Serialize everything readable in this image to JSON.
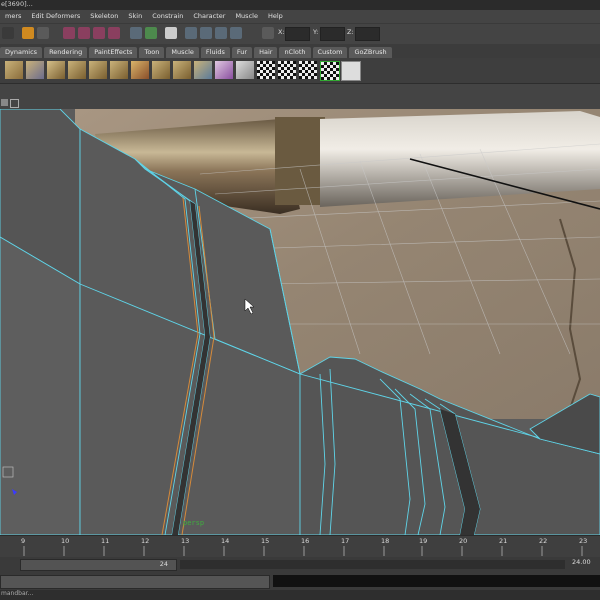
{
  "window": {
    "title": "e[3690]..."
  },
  "menubar": {
    "items": [
      "mers",
      "Edit Deformers",
      "Skeleton",
      "Skin",
      "Constrain",
      "Character",
      "Muscle",
      "Help"
    ]
  },
  "statusline": {
    "x_label": "X:",
    "y_label": "Y:",
    "z_label": "Z:"
  },
  "shelf": {
    "tabs": [
      "Dynamics",
      "Rendering",
      "PaintEffects",
      "Toon",
      "Muscle",
      "Fluids",
      "Fur",
      "Hair",
      "nCloth",
      "Custom",
      "GoZBrush"
    ],
    "icons": [
      "poly-plane-icon",
      "poly-cube-icon",
      "poly-cylinder-icon",
      "poly-cone-icon",
      "poly-box-icon",
      "poly-box-icon",
      "poly-shape-icon",
      "poly-tile-icon",
      "poly-shape-icon",
      "poly-shape-icon",
      "poly-pyramid-icon",
      "prism-icon",
      "checker-icon",
      "checker-icon",
      "checker-icon",
      "checker-icon",
      "goz-icon"
    ]
  },
  "viewport": {
    "camera_label": "persp",
    "colors": {
      "wire": "#5fd4e8",
      "edge_selected": "#d68a3a",
      "cam_label": "#3fae3f"
    }
  },
  "timeline": {
    "ticks": [
      "9",
      "10",
      "11",
      "12",
      "13",
      "14",
      "15",
      "16",
      "17",
      "18",
      "19",
      "20",
      "21",
      "22",
      "23"
    ],
    "current_frame_marker": "24"
  },
  "range": {
    "playback_value": "24",
    "end_value": "24.00"
  },
  "helpline": {
    "text": "mandbar..."
  }
}
